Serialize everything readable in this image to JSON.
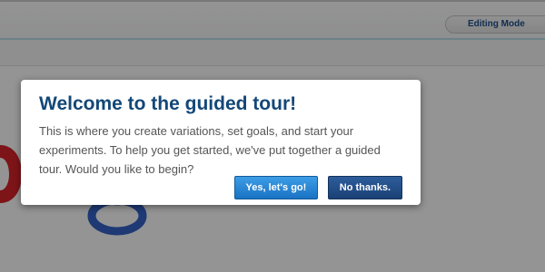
{
  "header": {
    "mode_label": "Editing Mode"
  },
  "dialog": {
    "title": "Welcome to the guided tour!",
    "body": "This is where you create variations, set goals, and start your experiments. To help you get started, we've put together a guided tour. Would you like to begin?",
    "primary_button": "Yes, let's go!",
    "secondary_button": "No thanks."
  },
  "colors": {
    "title": "#134777",
    "primary_button": "#2585d4",
    "secondary_button": "#234f88",
    "overlay": "#000000"
  },
  "icons": {
    "background_logo": "google-logo-fragment"
  }
}
